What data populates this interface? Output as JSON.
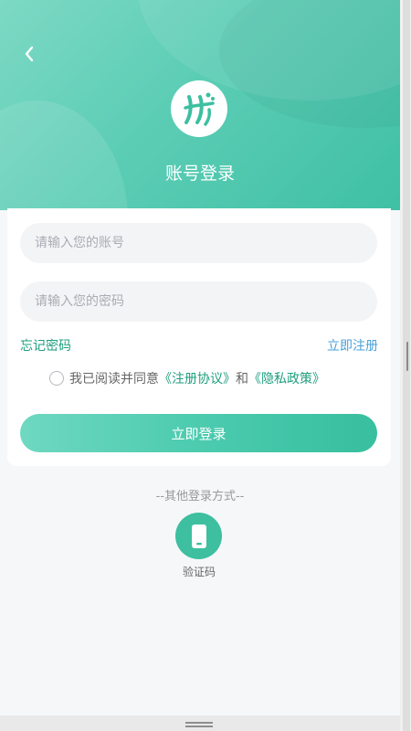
{
  "header": {
    "title": "账号登录",
    "back_icon": "chevron-left-icon",
    "logo_icon": "app-logo"
  },
  "form": {
    "account_placeholder": "请输入您的账号",
    "password_placeholder": "请输入您的密码",
    "forgot_label": "忘记密码",
    "register_label": "立即注册",
    "agreement": {
      "prefix": "我已阅读并同意",
      "register_agreement": "《注册协议》",
      "and": "和",
      "privacy_policy": "《隐私政策》",
      "checked": false
    },
    "login_label": "立即登录"
  },
  "other_login": {
    "title": "--其他登录方式--",
    "methods": [
      {
        "label": "验证码",
        "icon": "phone-icon"
      }
    ]
  },
  "colors": {
    "accent": "#3dbfa0",
    "link_green": "#1e9e7e",
    "link_blue": "#4aa0d8"
  }
}
